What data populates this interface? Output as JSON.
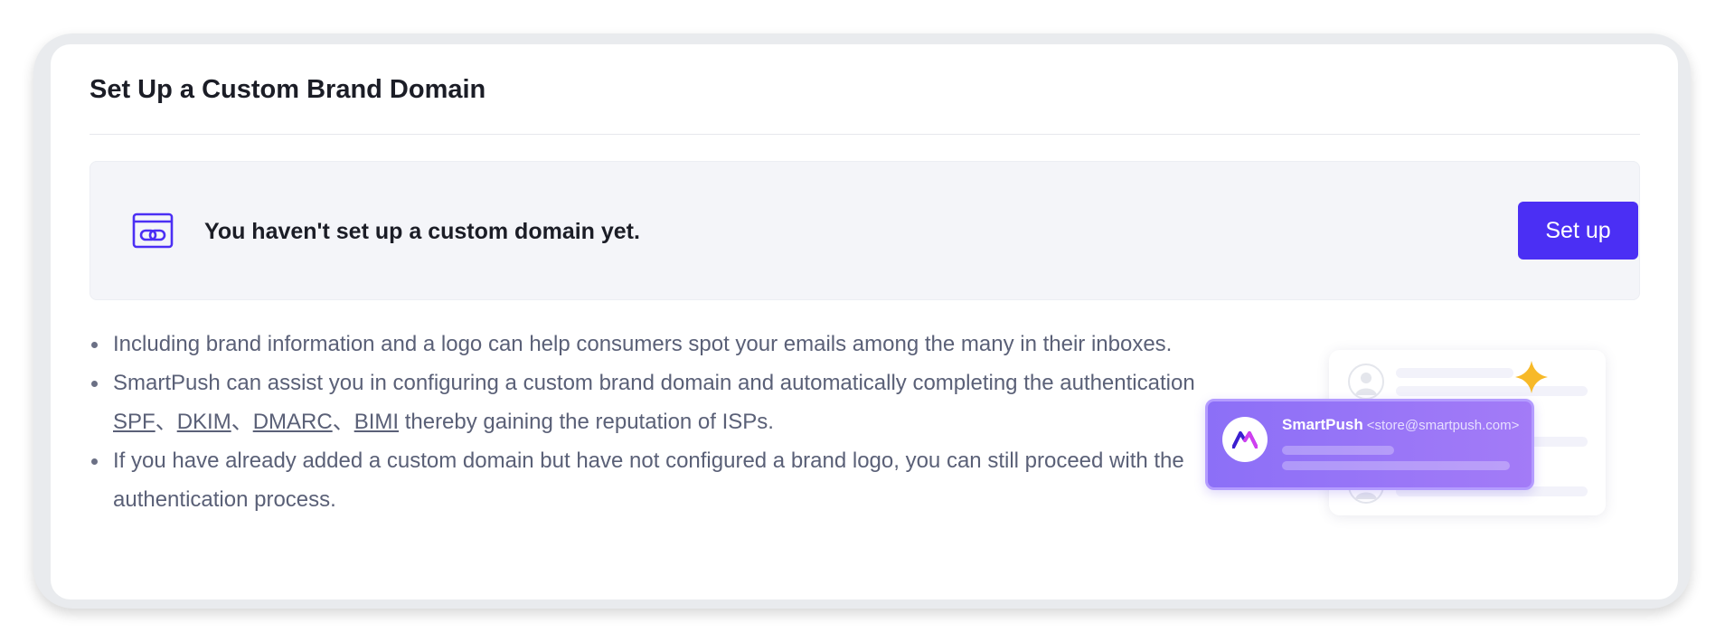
{
  "card": {
    "title": "Set Up a Custom Brand Domain"
  },
  "notice": {
    "icon": "link-window-icon",
    "message": "You haven't set up a custom domain yet.",
    "setup_label": "Set up"
  },
  "info": {
    "item1": "Including brand information and a logo can help consumers spot your emails among the many in their inboxes.",
    "item2_prefix": "SmartPush can assist you in configuring a custom brand domain and automatically completing the authentication ",
    "links": [
      "SPF",
      "DKIM",
      "DMARC",
      "BIMI"
    ],
    "separator": "、",
    "item2_suffix": " thereby gaining the reputation of ISPs.",
    "item3": "If you have already added a custom domain but have not configured a brand logo, you can still proceed with the authentication process."
  },
  "illustration": {
    "sender_name": "SmartPush",
    "sender_email": "<store@smartpush.com>",
    "logo_icon": "smartpush-logo-icon",
    "sparkle_icon": "sparkle-icon",
    "avatar_icon": "user-avatar-icon"
  },
  "colors": {
    "accent": "#4b2ff4",
    "sparkle": "#f7b928",
    "email_card": "#9a76f6"
  }
}
